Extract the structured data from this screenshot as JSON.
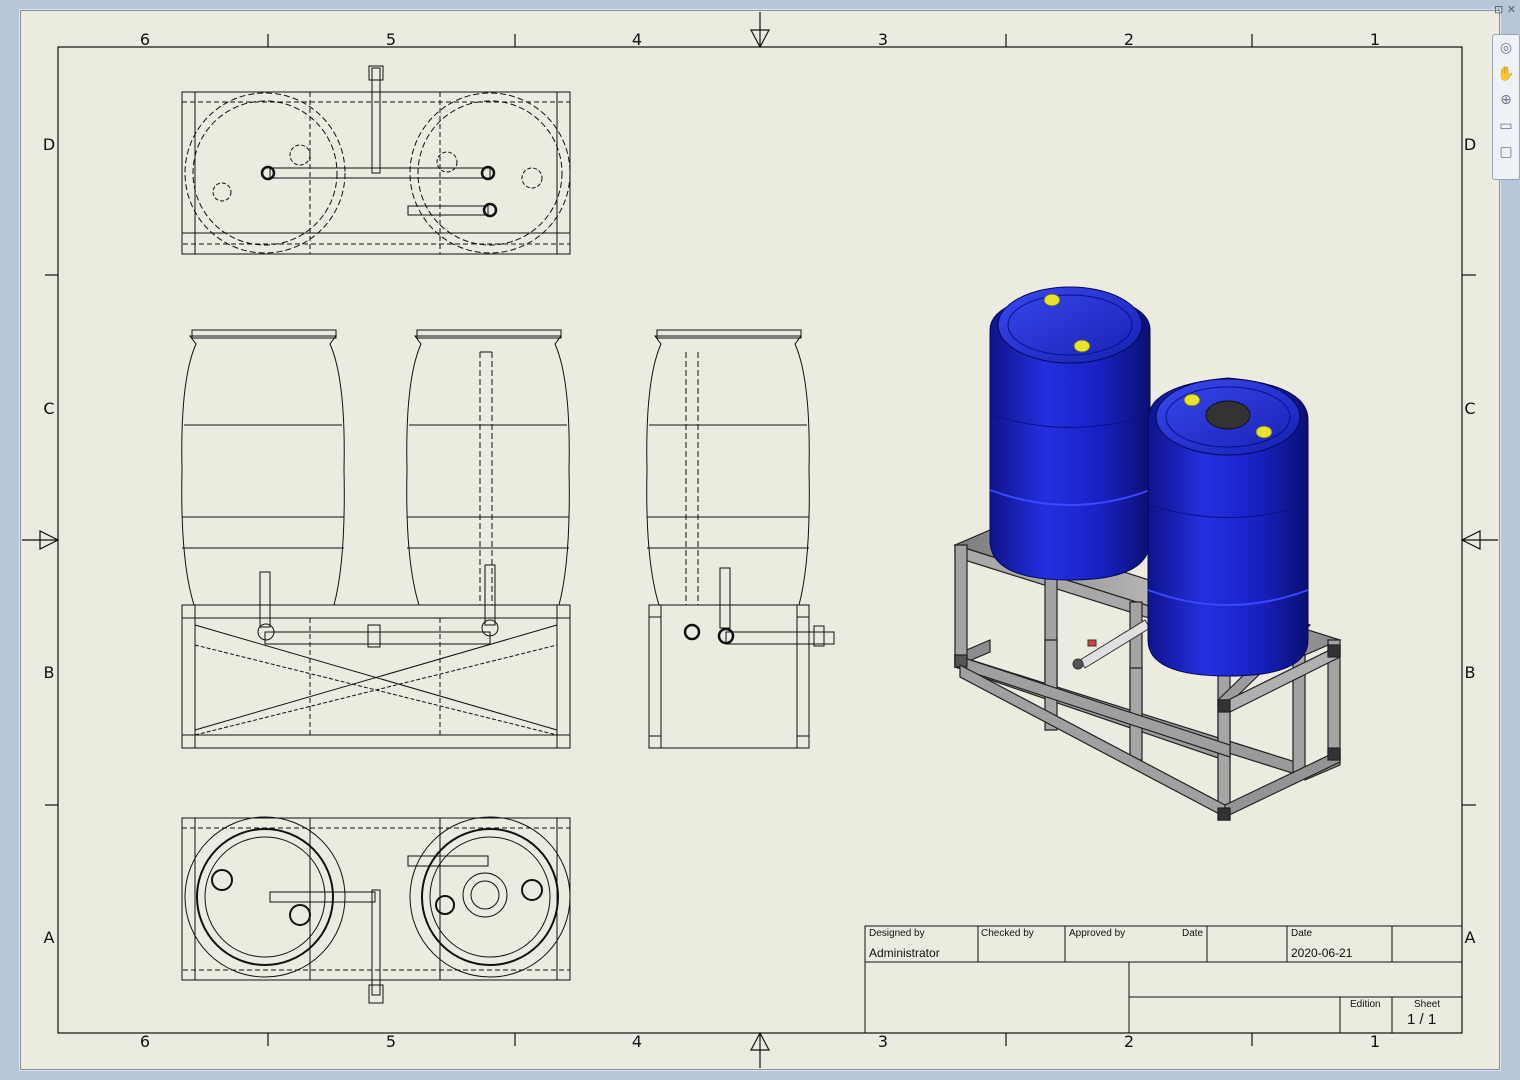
{
  "zones": {
    "columns": [
      "6",
      "5",
      "4",
      "3",
      "2",
      "1"
    ],
    "rows": [
      "D",
      "C",
      "B",
      "A"
    ]
  },
  "title_block": {
    "designed_by_label": "Designed by",
    "designed_by": "Administrator",
    "checked_by_label": "Checked by",
    "approved_by_label": "Approved by",
    "date_label_1": "Date",
    "date_label_2": "Date",
    "date": "2020-06-21",
    "edition_label": "Edition",
    "sheet_label": "Sheet",
    "sheet": "1 / 1"
  },
  "colors": {
    "paper": "#ecebdf",
    "line": "#111111",
    "barrel_blue": "#1a22c8",
    "frame_gray": "#9a9a9a",
    "cap_yellow": "#e8e22a"
  },
  "navigation_bar": {
    "icons": [
      "steering-wheel-icon",
      "pan-icon",
      "zoom-icon",
      "zoom-window-icon",
      "orbit-icon"
    ]
  }
}
